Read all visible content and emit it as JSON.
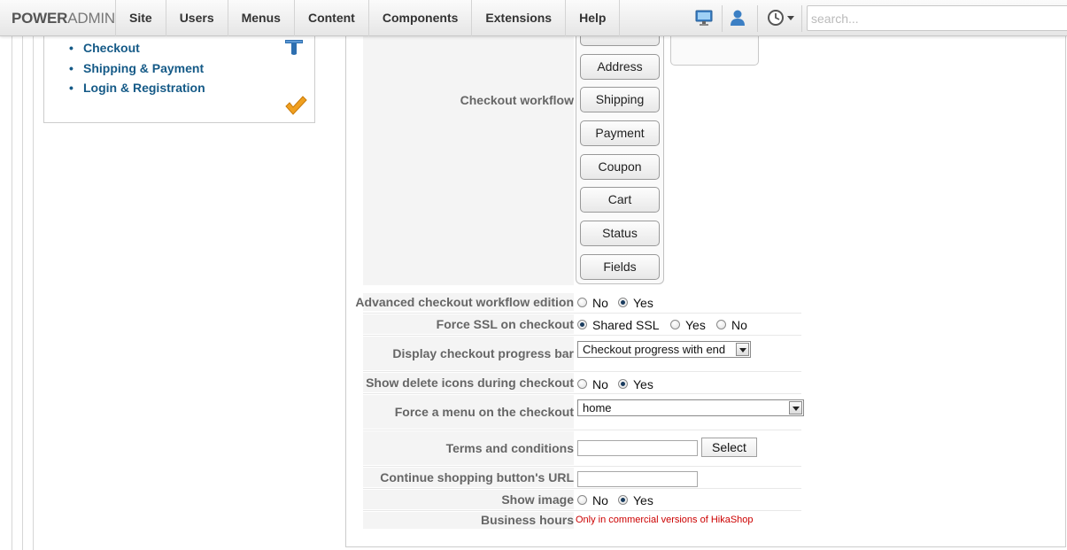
{
  "brand": {
    "part1": "POWER",
    "part2": "ADMIN"
  },
  "menu": [
    "Site",
    "Users",
    "Menus",
    "Content",
    "Components",
    "Extensions",
    "Help"
  ],
  "search": {
    "placeholder": "search..."
  },
  "left_links": [
    "Checkout",
    "Shipping & Payment",
    "Login & Registration"
  ],
  "workflow": {
    "label": "Checkout workflow",
    "buttons": [
      "Address",
      "Shipping",
      "Payment",
      "Coupon",
      "Cart",
      "Status",
      "Fields"
    ]
  },
  "settings": {
    "advanced": {
      "label": "Advanced checkout workflow edition",
      "options": [
        "No",
        "Yes"
      ],
      "selected": "Yes"
    },
    "ssl": {
      "label": "Force SSL on checkout",
      "options": [
        "Shared SSL",
        "Yes",
        "No"
      ],
      "selected": "Shared SSL"
    },
    "progress": {
      "label": "Display checkout progress bar",
      "value": "Checkout progress with end"
    },
    "delete_icons": {
      "label": "Show delete icons during checkout",
      "options": [
        "No",
        "Yes"
      ],
      "selected": "Yes"
    },
    "force_menu": {
      "label": "Force a menu on the checkout",
      "value": "home"
    },
    "terms": {
      "label": "Terms and conditions",
      "value": "",
      "button": "Select"
    },
    "continue_url": {
      "label": "Continue shopping button's URL",
      "value": ""
    },
    "show_image": {
      "label": "Show image",
      "options": [
        "No",
        "Yes"
      ],
      "selected": "Yes"
    },
    "business_hours": {
      "label": "Business hours",
      "note": "Only in commercial versions of HikaShop"
    }
  },
  "colors": {
    "link": "#155a87",
    "note": "#cc0000",
    "accent_icon": "#2d6fb0",
    "check": "#f0a020"
  }
}
